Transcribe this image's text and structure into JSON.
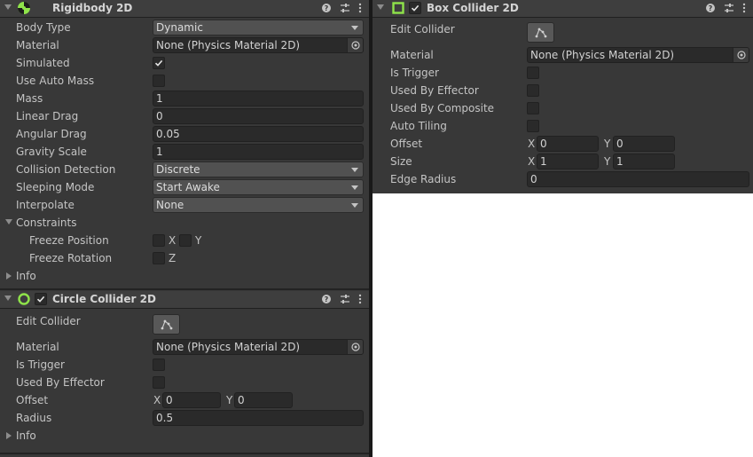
{
  "rigidbody": {
    "title": "Rigidbody 2D",
    "body_type": {
      "label": "Body Type",
      "value": "Dynamic"
    },
    "material": {
      "label": "Material",
      "value": "None (Physics Material 2D)"
    },
    "simulated": {
      "label": "Simulated",
      "checked": true
    },
    "use_auto_mass": {
      "label": "Use Auto Mass",
      "checked": false
    },
    "mass": {
      "label": "Mass",
      "value": "1"
    },
    "linear_drag": {
      "label": "Linear Drag",
      "value": "0"
    },
    "angular_drag": {
      "label": "Angular Drag",
      "value": "0.05"
    },
    "gravity_scale": {
      "label": "Gravity Scale",
      "value": "1"
    },
    "collision_detection": {
      "label": "Collision Detection",
      "value": "Discrete"
    },
    "sleeping_mode": {
      "label": "Sleeping Mode",
      "value": "Start Awake"
    },
    "interpolate": {
      "label": "Interpolate",
      "value": "None"
    },
    "constraints": {
      "label": "Constraints",
      "expanded": true
    },
    "freeze_position": {
      "label": "Freeze Position",
      "x_label": "X",
      "y_label": "Y"
    },
    "freeze_rotation": {
      "label": "Freeze Rotation",
      "z_label": "Z"
    },
    "info": {
      "label": "Info",
      "expanded": false
    }
  },
  "circle_collider": {
    "title": "Circle Collider 2D",
    "enabled": true,
    "edit_collider": {
      "label": "Edit Collider"
    },
    "material": {
      "label": "Material",
      "value": "None (Physics Material 2D)"
    },
    "is_trigger": {
      "label": "Is Trigger",
      "checked": false
    },
    "used_by_effector": {
      "label": "Used By Effector",
      "checked": false
    },
    "offset": {
      "label": "Offset",
      "x_label": "X",
      "x": "0",
      "y_label": "Y",
      "y": "0"
    },
    "radius": {
      "label": "Radius",
      "value": "0.5"
    },
    "info": {
      "label": "Info",
      "expanded": false
    }
  },
  "box_collider": {
    "title": "Box Collider 2D",
    "enabled": true,
    "edit_collider": {
      "label": "Edit Collider"
    },
    "material": {
      "label": "Material",
      "value": "None (Physics Material 2D)"
    },
    "is_trigger": {
      "label": "Is Trigger",
      "checked": false
    },
    "used_by_effector": {
      "label": "Used By Effector",
      "checked": false
    },
    "used_by_composite": {
      "label": "Used By Composite",
      "checked": false
    },
    "auto_tiling": {
      "label": "Auto Tiling",
      "checked": false
    },
    "offset": {
      "label": "Offset",
      "x_label": "X",
      "x": "0",
      "y_label": "Y",
      "y": "0"
    },
    "size": {
      "label": "Size",
      "x_label": "X",
      "x": "1",
      "y_label": "Y",
      "y": "1"
    },
    "edge_radius": {
      "label": "Edge Radius",
      "value": "0"
    }
  },
  "icons": {
    "rigidbody": "rigidbody-icon",
    "circle_collider": "circle-collider-icon",
    "box_collider": "box-collider-icon",
    "help": "help-icon",
    "presets": "presets-icon",
    "more": "more-options-icon",
    "edit_collider": "edit-collider-icon",
    "object_picker": "object-picker-icon"
  },
  "colors": {
    "panel_bg": "#383838",
    "header_bg": "#3e3e3e",
    "field_bg": "#2a2a2a",
    "dropdown_bg": "#515151",
    "text": "#c4c4c4",
    "collider_green": "#8fe34a"
  }
}
